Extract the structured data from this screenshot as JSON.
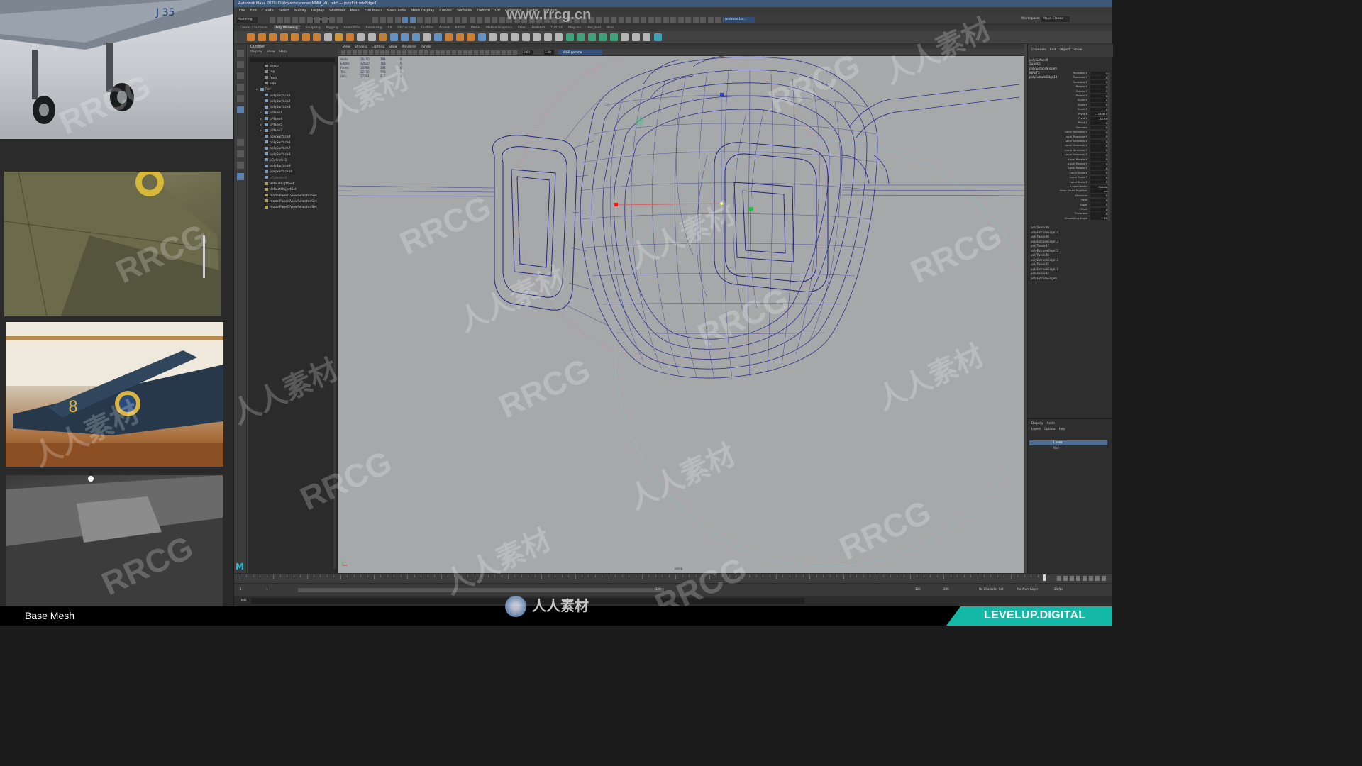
{
  "window": {
    "title": "Autodesk Maya 2020: D:\\Projects\\scenes\\MMM_v01.mb* --- polyExtrudeEdge1"
  },
  "menubar": [
    "File",
    "Edit",
    "Create",
    "Select",
    "Modify",
    "Display",
    "Windows",
    "Mesh",
    "Edit Mesh",
    "Mesh Tools",
    "Mesh Display",
    "Curves",
    "Surfaces",
    "Deform",
    "UV",
    "Generate",
    "Cache",
    "Redshift"
  ],
  "statusline": {
    "menuset": "Modeling",
    "mode": "Components",
    "user": "Andreas Lie..."
  },
  "workspace": {
    "label": "Workspace:",
    "value": "Maya Classic"
  },
  "shelf_tabs": [
    "Curves / Surfaces",
    "Poly Modeling",
    "Sculpting",
    "Rigging",
    "Animation",
    "Rendering",
    "FX",
    "FX Caching",
    "Custom",
    "Arnold",
    "Bifrost",
    "MASH",
    "Motion Graphics",
    "XGen",
    "Redshift",
    "TURTLE",
    "Plug-ins",
    "Hair_tool",
    "Bliss"
  ],
  "shelf_active": "Poly Modeling",
  "outliner": {
    "title": "Outliner",
    "menu": [
      "Display",
      "Show",
      "Help"
    ],
    "items": [
      {
        "label": "persp",
        "icon": "camera-icon"
      },
      {
        "label": "top",
        "icon": "camera-icon"
      },
      {
        "label": "front",
        "icon": "camera-icon"
      },
      {
        "label": "side",
        "icon": "camera-icon"
      },
      {
        "label": "Ref",
        "icon": "group-icon"
      },
      {
        "label": "polySurface1",
        "icon": "mesh-icon"
      },
      {
        "label": "polySurface2",
        "icon": "mesh-icon"
      },
      {
        "label": "polySurface3",
        "icon": "mesh-icon"
      },
      {
        "label": "pPlane1",
        "icon": "group-icon"
      },
      {
        "label": "pPlane4",
        "icon": "group-icon"
      },
      {
        "label": "pPlane5",
        "icon": "group-icon"
      },
      {
        "label": "pPlane7",
        "icon": "group-icon"
      },
      {
        "label": "polySurface4",
        "icon": "mesh-icon"
      },
      {
        "label": "polySurface6",
        "icon": "mesh-icon"
      },
      {
        "label": "polySurface7",
        "icon": "mesh-icon"
      },
      {
        "label": "polySurface8",
        "icon": "mesh-icon"
      },
      {
        "label": "pCylinder1",
        "icon": "mesh-icon"
      },
      {
        "label": "polySurface9",
        "icon": "mesh-icon"
      },
      {
        "label": "polySurface10",
        "icon": "mesh-icon"
      },
      {
        "label": "pCylinder2",
        "icon": "mesh-icon"
      },
      {
        "label": "defaultLightSet",
        "icon": "set-icon"
      },
      {
        "label": "defaultObjectSet",
        "icon": "set-icon"
      },
      {
        "label": "modelPanel1ViewSelectedSet",
        "icon": "set-icon"
      },
      {
        "label": "modelPanel4ViewSelectedSet",
        "icon": "set-icon"
      },
      {
        "label": "modelPanel2ViewSelectedSet",
        "icon": "set-icon"
      }
    ]
  },
  "viewport": {
    "menu": [
      "View",
      "Shading",
      "Lighting",
      "Show",
      "Renderer",
      "Panels"
    ],
    "hud": [
      [
        "Verts:",
        "16450",
        "384",
        "0"
      ],
      [
        "Edges:",
        "32820",
        "768",
        "0"
      ],
      [
        "Faces:",
        "16368",
        "384",
        "0"
      ],
      [
        "Tris:",
        "32736",
        "768",
        "0"
      ],
      [
        "UVs:",
        "17264",
        "432",
        "0"
      ]
    ],
    "camera_label": "persp",
    "gamma_label": "sRGB gamma",
    "exposure": "0.00",
    "gamma": "1.00"
  },
  "channelbox": {
    "tabs": [
      "Channels",
      "Edit",
      "Object",
      "Show"
    ],
    "object": "polySurface9",
    "shapes_label": "SHAPES",
    "shape_name": "polySurfaceShape9",
    "inputs_label": "INPUTS",
    "input_name": "polyExtrudeEdge14",
    "attrs": [
      {
        "k": "Translate X",
        "v": "0"
      },
      {
        "k": "Translate Y",
        "v": "0"
      },
      {
        "k": "Translate Z",
        "v": "0"
      },
      {
        "k": "Rotate X",
        "v": "0"
      },
      {
        "k": "Rotate Y",
        "v": "0"
      },
      {
        "k": "Rotate Z",
        "v": "0"
      },
      {
        "k": "Scale X",
        "v": "1"
      },
      {
        "k": "Scale Y",
        "v": "1"
      },
      {
        "k": "Scale Z",
        "v": "1"
      },
      {
        "k": "Pivot X",
        "v": "-118.571"
      },
      {
        "k": "Pivot Y",
        "v": "-32.39"
      },
      {
        "k": "Pivot Z",
        "v": "0"
      },
      {
        "k": "Random",
        "v": "0"
      },
      {
        "k": "Local Translate X",
        "v": "0"
      },
      {
        "k": "Local Translate Y",
        "v": "0"
      },
      {
        "k": "Local Translate Z",
        "v": "0"
      },
      {
        "k": "Local Direction X",
        "v": "1"
      },
      {
        "k": "Local Direction Y",
        "v": "0"
      },
      {
        "k": "Local Direction Z",
        "v": "0"
      },
      {
        "k": "Local Rotate X",
        "v": "0"
      },
      {
        "k": "Local Rotate Y",
        "v": "0"
      },
      {
        "k": "Local Rotate Z",
        "v": "0"
      },
      {
        "k": "Local Scale X",
        "v": "1"
      },
      {
        "k": "Local Scale Y",
        "v": "1"
      },
      {
        "k": "Local Scale Z",
        "v": "1"
      },
      {
        "k": "Local Center",
        "v": "Middle"
      },
      {
        "k": "Keep Faces Together",
        "v": "on"
      },
      {
        "k": "Divisions",
        "v": "1"
      },
      {
        "k": "Twist",
        "v": "0"
      },
      {
        "k": "Taper",
        "v": "1"
      },
      {
        "k": "Offset",
        "v": "0"
      },
      {
        "k": "Thickness",
        "v": "0"
      },
      {
        "k": "Smoothing Angle",
        "v": "30"
      }
    ],
    "history": [
      "polyTweak49",
      "polyExtrudeEdge14",
      "polyTweak48",
      "polyExtrudeEdge13",
      "polyTweak47",
      "polyExtrudeEdge12",
      "polyTweak46",
      "polyExtrudeEdge11",
      "polyTweak45",
      "polyExtrudeEdge10",
      "polyTweak44",
      "polyExtrudeEdge9"
    ]
  },
  "layer_editor": {
    "tabs": [
      "Display",
      "Anim"
    ],
    "menu": [
      "Layers",
      "Options",
      "Help"
    ],
    "layers": [
      "Layer",
      "Ref"
    ]
  },
  "timeline": {
    "start": "1",
    "start_inner": "1",
    "range_end": "120",
    "end_inner": "120",
    "end": "200",
    "current": "120",
    "char_set": "No Character Set",
    "anim_layer": "No Anim Layer",
    "fps": "24 fps"
  },
  "commandline": {
    "label": "MEL"
  },
  "overlay": {
    "caption": "Base Mesh",
    "brand": "LEVELUP.DIGITAL",
    "site_watermark": "www.rrcg.cn",
    "bottom_watermark": "人人素材",
    "wm_en": "RRCG",
    "wm_cn": "人人素材"
  },
  "colors": {
    "viewport_bg": "#a7a8aa",
    "wire": "#2d2f8c",
    "brand": "#14b8a6",
    "titlebar": "#3d5878"
  }
}
